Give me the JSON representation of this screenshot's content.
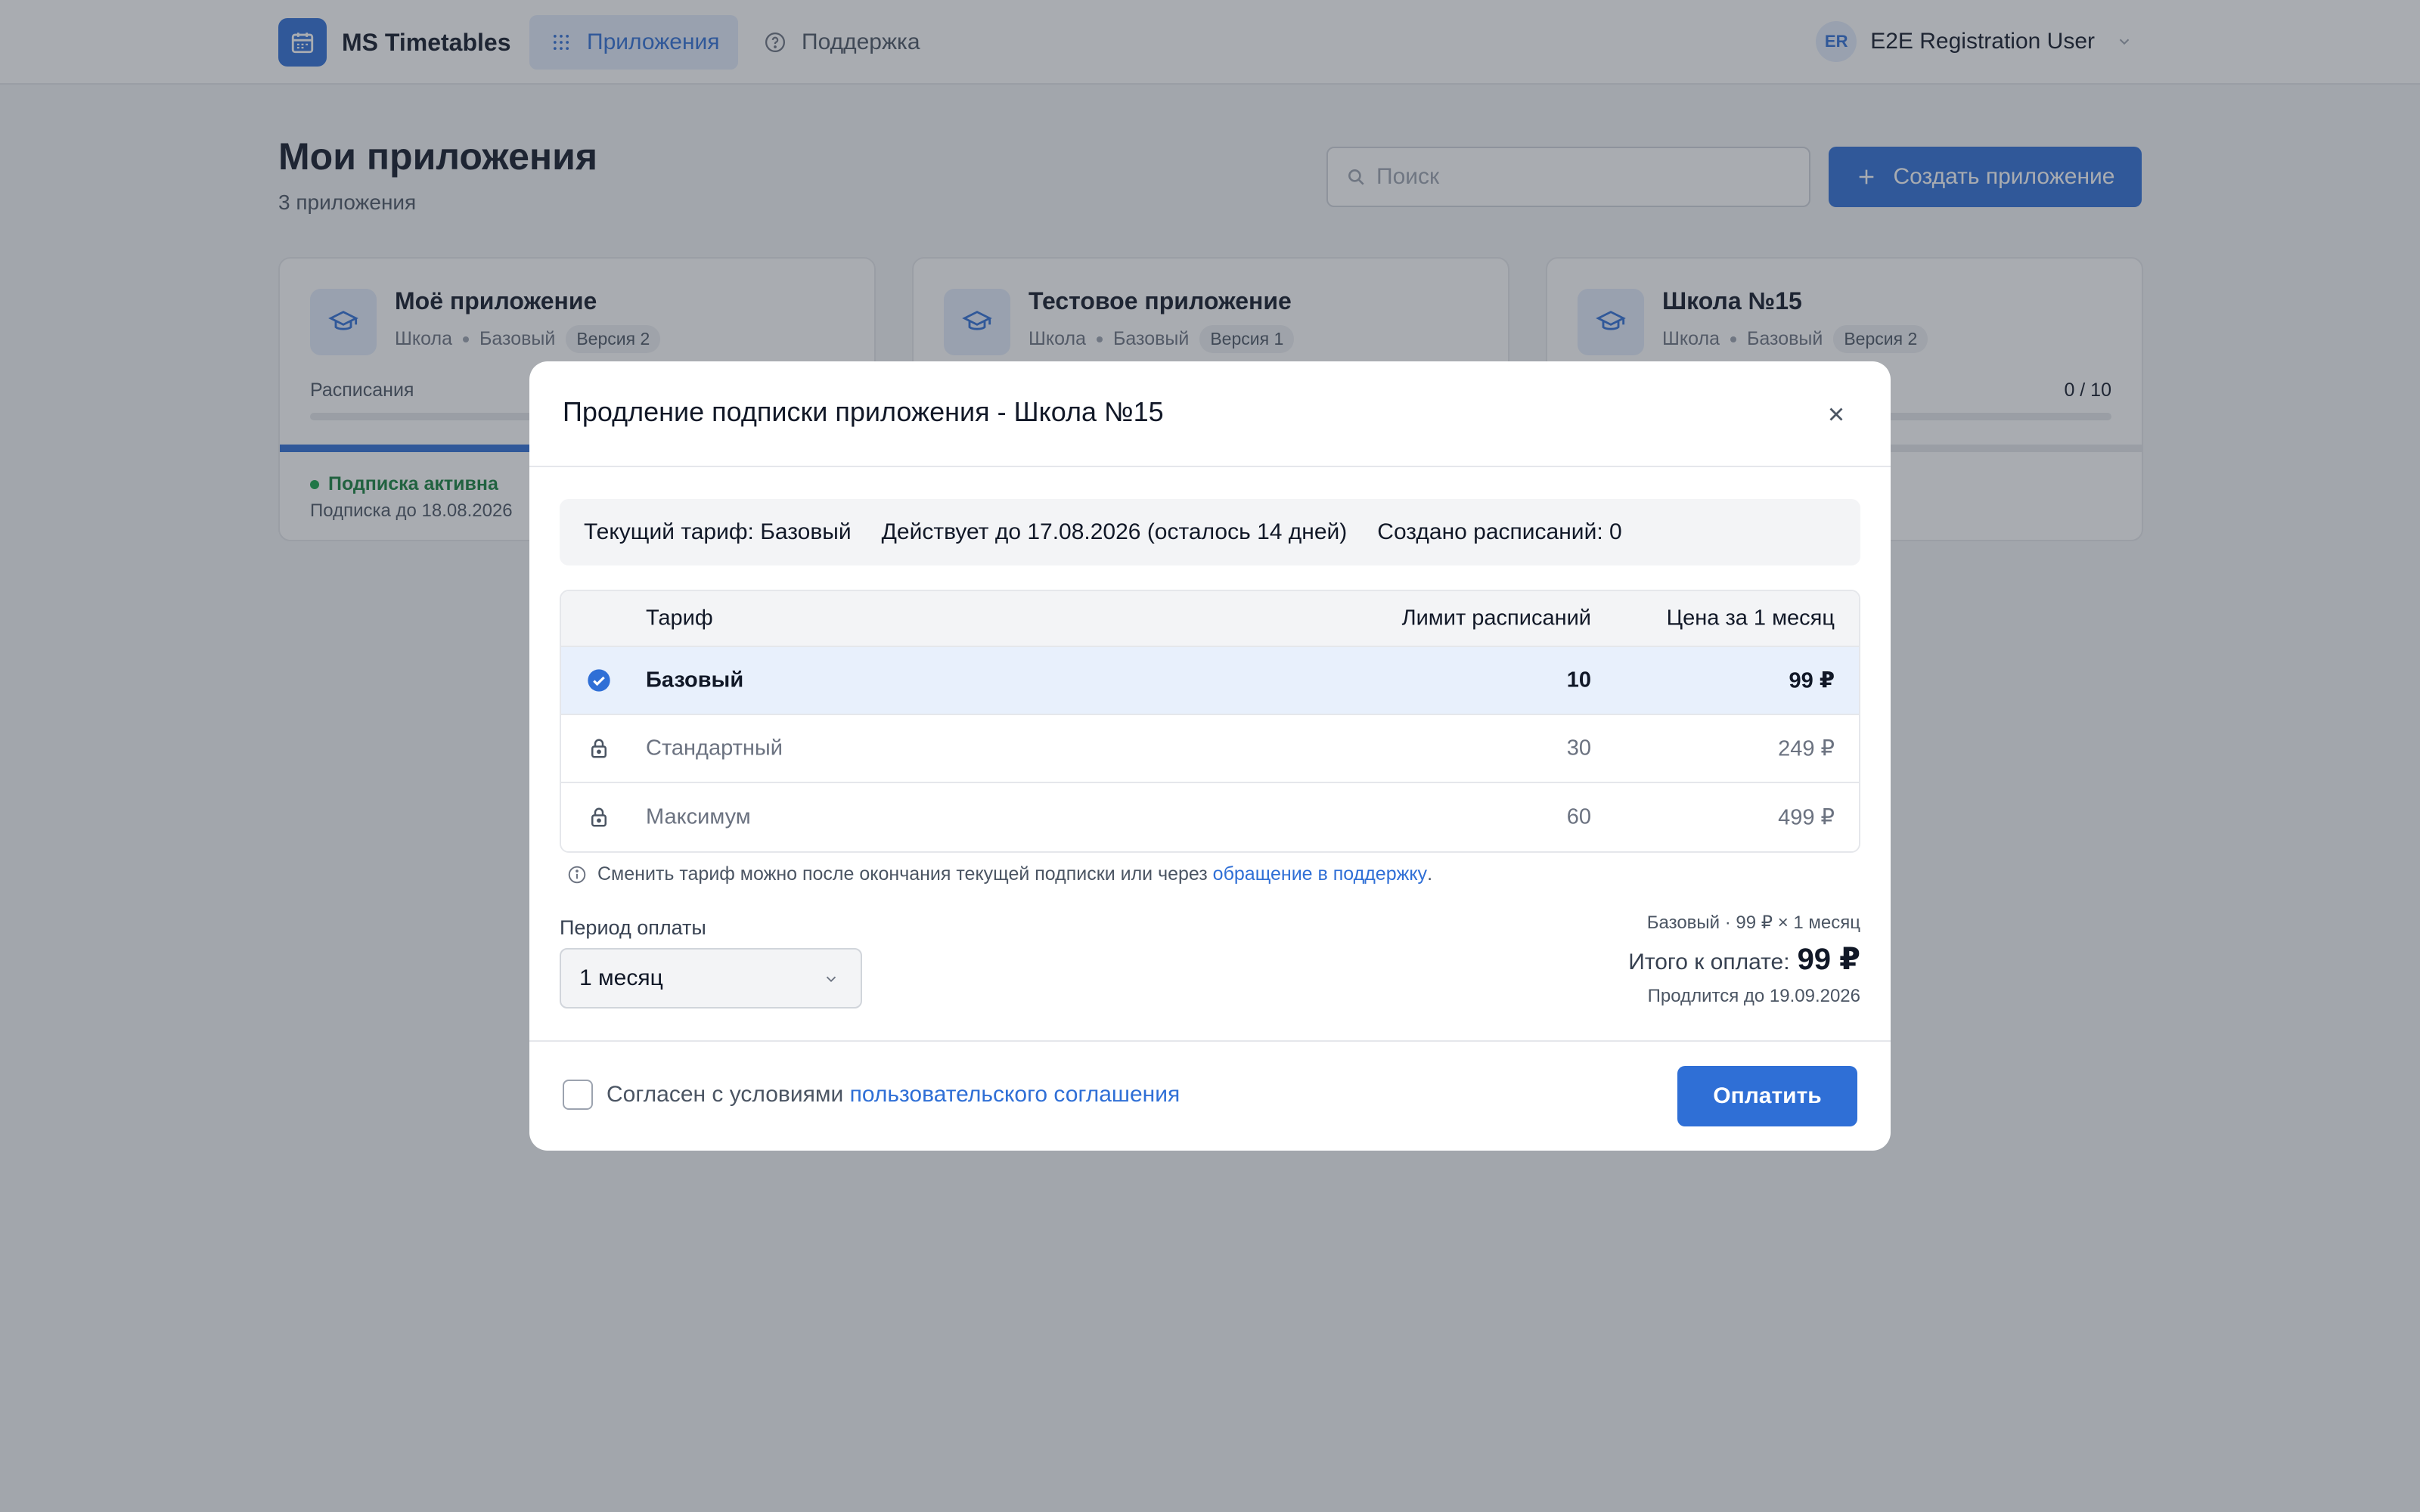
{
  "header": {
    "brand": "MS Timetables",
    "nav_apps": "Приложения",
    "nav_support": "Поддержка",
    "user_initials": "ER",
    "user_name": "E2E Registration User"
  },
  "page": {
    "title": "Мои приложения",
    "subtitle": "3 приложения",
    "search_placeholder": "Поиск",
    "create_label": "Создать приложение"
  },
  "cards": [
    {
      "title": "Моё приложение",
      "type": "Школа",
      "plan": "Базовый",
      "version": "Версия 2",
      "label": "Расписания",
      "status": "Подписка активна",
      "until": "Подписка до 18.08.2026"
    },
    {
      "title": "Тестовое приложение",
      "type": "Школа",
      "plan": "Базовый",
      "version": "Версия 1"
    },
    {
      "title": "Школа №15",
      "type": "Школа",
      "plan": "Базовый",
      "version": "Версия 2",
      "count": "0 / 10"
    }
  ],
  "modal": {
    "title": "Продление подписки приложения - Школа №15",
    "info": {
      "current_plan": "Текущий тариф: Базовый",
      "valid_until": "Действует до 17.08.2026 (осталось 14 дней)",
      "created": "Создано расписаний: 0"
    },
    "table": {
      "headers": {
        "plan": "Тариф",
        "limit": "Лимит расписаний",
        "price": "Цена за 1 месяц"
      },
      "rows": [
        {
          "name": "Базовый",
          "limit": "10",
          "price": "99 ₽"
        },
        {
          "name": "Стандартный",
          "limit": "30",
          "price": "249 ₽"
        },
        {
          "name": "Максимум",
          "limit": "60",
          "price": "499 ₽"
        }
      ]
    },
    "hint_text": "Сменить тариф можно после окончания текущей подписки или через ",
    "hint_link": "обращение в поддержку",
    "hint_end": ".",
    "period_label": "Период оплаты",
    "period_value": "1 месяц",
    "summary_line": "Базовый · 99 ₽ × 1 месяц",
    "total_label": "Итого к оплате:",
    "total_amount": "99 ₽",
    "extends": "Продлится до 19.09.2026",
    "agree_text": "Согласен с условиями ",
    "agree_link": "пользовательского соглашения",
    "pay_label": "Оплатить"
  },
  "colors": {
    "accent": "#2f6fd6",
    "success": "#16a34a",
    "overlay": "rgba(50,58,70,0.42)"
  }
}
